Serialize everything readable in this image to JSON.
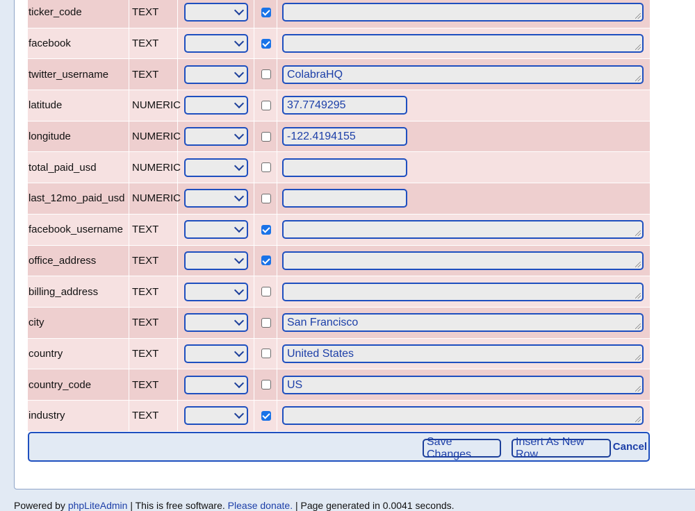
{
  "rows": [
    {
      "name": "ticker_code",
      "type": "TEXT",
      "null": true,
      "value": "",
      "input": "textarea"
    },
    {
      "name": "facebook",
      "type": "TEXT",
      "null": true,
      "value": "",
      "input": "textarea"
    },
    {
      "name": "twitter_username",
      "type": "TEXT",
      "null": false,
      "value": "ColabraHQ",
      "input": "textarea"
    },
    {
      "name": "latitude",
      "type": "NUMERIC",
      "null": false,
      "value": "37.7749295",
      "input": "text"
    },
    {
      "name": "longitude",
      "type": "NUMERIC",
      "null": false,
      "value": "-122.4194155",
      "input": "text"
    },
    {
      "name": "total_paid_usd",
      "type": "NUMERIC",
      "null": false,
      "value": "",
      "input": "text"
    },
    {
      "name": "last_12mo_paid_usd",
      "type": "NUMERIC",
      "null": false,
      "value": "",
      "input": "text"
    },
    {
      "name": "facebook_username",
      "type": "TEXT",
      "null": true,
      "value": "",
      "input": "textarea"
    },
    {
      "name": "office_address",
      "type": "TEXT",
      "null": true,
      "value": "",
      "input": "textarea"
    },
    {
      "name": "billing_address",
      "type": "TEXT",
      "null": false,
      "value": "",
      "input": "textarea"
    },
    {
      "name": "city",
      "type": "TEXT",
      "null": false,
      "value": "San Francisco",
      "input": "textarea"
    },
    {
      "name": "country",
      "type": "TEXT",
      "null": false,
      "value": "United States",
      "input": "textarea"
    },
    {
      "name": "country_code",
      "type": "TEXT",
      "null": false,
      "value": "US",
      "input": "textarea"
    },
    {
      "name": "industry",
      "type": "TEXT",
      "null": true,
      "value": "",
      "input": "textarea"
    }
  ],
  "actions": {
    "save_label": "Save Changes",
    "insert_label": "Insert As New Row",
    "cancel_label": "Cancel"
  },
  "footer": {
    "prefix": "Powered by ",
    "app_link": "phpLiteAdmin",
    "middle": " | This is free software. ",
    "donate_link": "Please donate.",
    "suffix": " | Page generated in 0.0041 seconds."
  },
  "colors": {
    "row_odd": "#eecfcf",
    "row_even": "#f6e1e1",
    "accent": "#1e4fbf",
    "checkbox_on": "#1a73e8"
  }
}
